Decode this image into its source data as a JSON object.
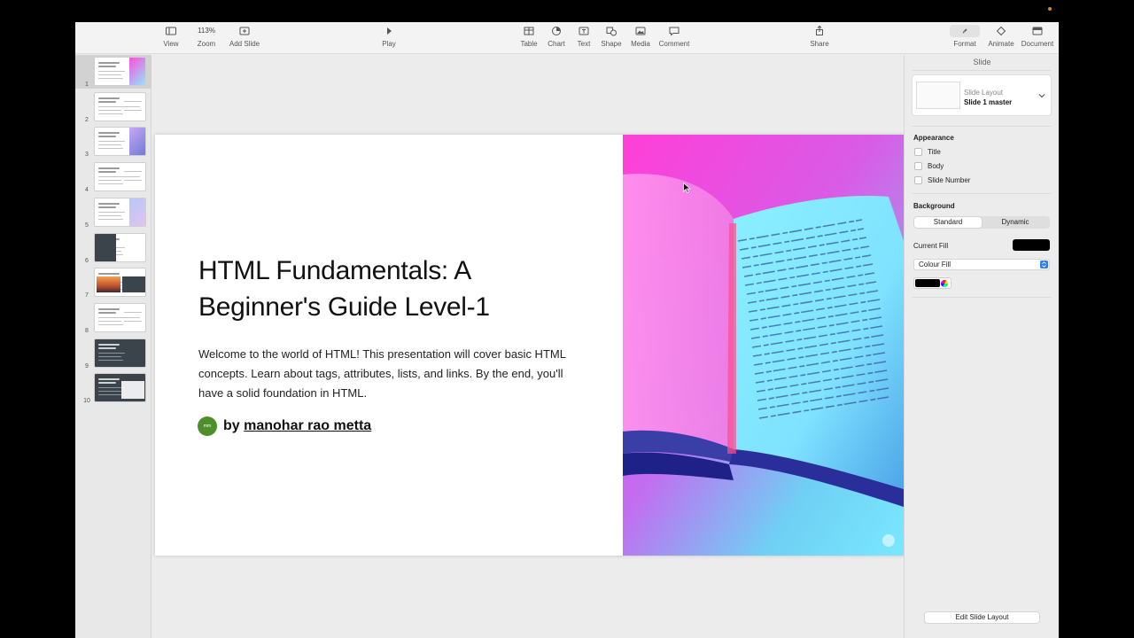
{
  "toolbar": {
    "view": "View",
    "zoom_value": "113%",
    "zoom": "Zoom",
    "add_slide": "Add Slide",
    "play": "Play",
    "table": "Table",
    "chart": "Chart",
    "text": "Text",
    "shape": "Shape",
    "media": "Media",
    "comment": "Comment",
    "share": "Share",
    "format": "Format",
    "animate": "Animate",
    "document": "Document"
  },
  "navigator": {
    "slides": [
      {
        "number": "1"
      },
      {
        "number": "2"
      },
      {
        "number": "3"
      },
      {
        "number": "4"
      },
      {
        "number": "5"
      },
      {
        "number": "6"
      },
      {
        "number": "7"
      },
      {
        "number": "8"
      },
      {
        "number": "9"
      },
      {
        "number": "10"
      }
    ],
    "selected_index": 0
  },
  "slide": {
    "title": "HTML Fundamentals: A Beginner's Guide Level-1",
    "body": "Welcome to the world of HTML! This presentation will cover basic HTML concepts. Learn about tags, attributes, lists, and links. By the end, you'll have a solid foundation in HTML.",
    "author_prefix": "by ",
    "author_name": "manohar rao metta",
    "avatar_initials": "mm"
  },
  "inspector": {
    "title": "Slide",
    "layout_label": "Slide Layout",
    "layout_value": "Slide 1 master",
    "appearance": "Appearance",
    "appearance_items": [
      "Title",
      "Body",
      "Slide Number"
    ],
    "background": "Background",
    "segment_standard": "Standard",
    "segment_dynamic": "Dynamic",
    "current_fill": "Current Fill",
    "fill_type": "Colour Fill",
    "edit_layout": "Edit Slide Layout"
  },
  "colors": {
    "accent": "#2f7cf6",
    "avatar": "#4e8f2c",
    "fill": "#000000"
  }
}
